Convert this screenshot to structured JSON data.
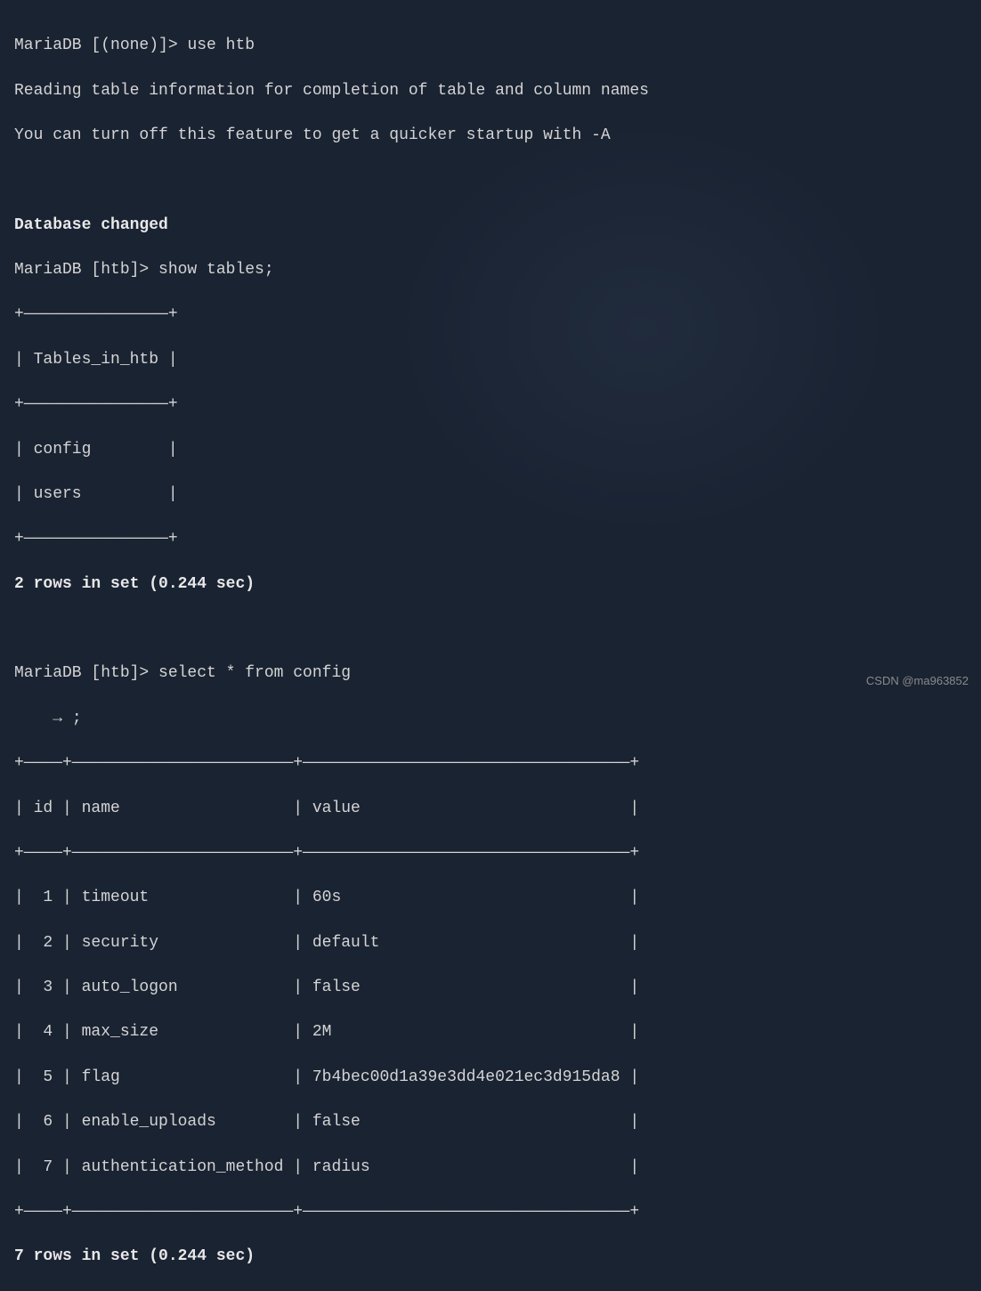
{
  "prompts": {
    "none": "MariaDB [(none)]> ",
    "htb": "MariaDB [htb]> ",
    "cont": "    → "
  },
  "commands": {
    "use": "use htb",
    "show_tables": "show tables;",
    "select_config": "select * from config",
    "cont_semi": ";"
  },
  "messages": {
    "reading": "Reading table information for completion of table and column names",
    "turnoff": "You can turn off this feature to get a quicker startup with -A",
    "dbchanged": "Database changed",
    "rows2": "2 rows in set (0.244 sec)",
    "rows7": "7 rows in set (0.244 sec)"
  },
  "tables_result": {
    "border_top": "+———————————————+",
    "header": "| Tables_in_htb |",
    "border_mid": "+———————————————+",
    "rows": [
      "| config        |",
      "| users         |"
    ],
    "border_bot": "+———————————————+"
  },
  "config_result": {
    "border_top": "+————+———————————————————————+——————————————————————————————————+",
    "header": "| id | name                  | value                            |",
    "border_mid": "+————+———————————————————————+——————————————————————————————————+",
    "rows": [
      "|  1 | timeout               | 60s                              |",
      "|  2 | security              | default                          |",
      "|  3 | auto_logon            | false                            |",
      "|  4 | max_size              | 2M                               |",
      "|  5 | flag                  | 7b4bec00d1a39e3dd4e021ec3d915da8 |",
      "|  6 | enable_uploads        | false                            |",
      "|  7 | authentication_method | radius                           |"
    ],
    "border_bot": "+————+———————————————————————+——————————————————————————————————+"
  },
  "watermark": "CSDN @ma963852"
}
